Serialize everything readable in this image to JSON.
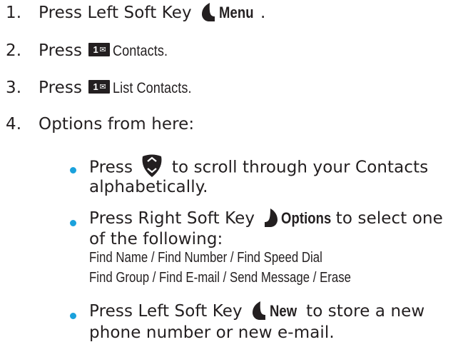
{
  "steps": [
    {
      "num": "1.",
      "pre": "Press Left Soft Key",
      "key": "Menu",
      "post": "."
    },
    {
      "num": "2.",
      "pre": "Press",
      "key_icon": "1",
      "post": "Contacts."
    },
    {
      "num": "3.",
      "pre": "Press",
      "key_icon": "1",
      "post": "List Contacts."
    },
    {
      "num": "4.",
      "text": "Options from here:"
    }
  ],
  "bullets": [
    {
      "line1_pre": "Press",
      "line1_post": "to scroll through your Contacts",
      "line2": "alphabetically."
    },
    {
      "line1_pre": "Press Right Soft Key",
      "key": "Options",
      "line1_post": "to select one",
      "line2": "of the following:",
      "sub1": "Find Name / Find Number / Find Speed Dial",
      "sub2": "Find Group / Find E-mail / Send Message / Erase"
    },
    {
      "line1_pre": "Press Left Soft Key",
      "key": "New",
      "line1_post": "to store a new",
      "line2": "phone number or new e-mail."
    }
  ],
  "icons": [
    "left-soft-key-icon",
    "keypad-1-icon",
    "navigation-key-icon",
    "right-soft-key-icon"
  ],
  "colors": {
    "text": "#231f20",
    "bullet": "#1aa1dc"
  }
}
